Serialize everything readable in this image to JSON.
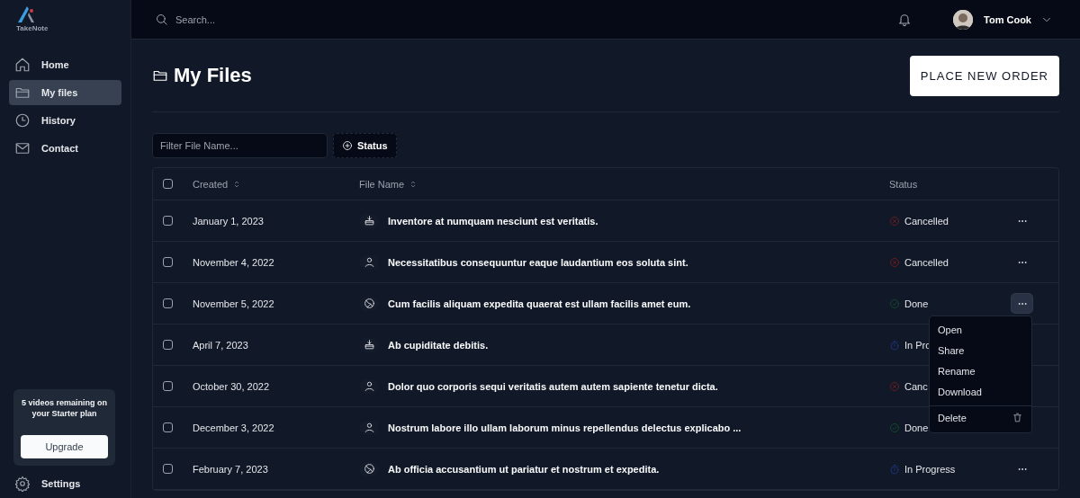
{
  "brand": {
    "name": "TakeNote"
  },
  "sidebar": {
    "items": [
      {
        "label": "Home",
        "selected": false
      },
      {
        "label": "My files",
        "selected": true
      },
      {
        "label": "History",
        "selected": false
      },
      {
        "label": "Contact",
        "selected": false
      }
    ],
    "plan_card": {
      "message": "5 videos remaining on your Starter plan",
      "button": "Upgrade"
    },
    "footer_item": {
      "label": "Settings"
    }
  },
  "topbar": {
    "search": {
      "placeholder": "Search..."
    },
    "user": {
      "name": "Tom Cook"
    }
  },
  "page": {
    "title": "My Files",
    "primary_button": "PLACE NEW ORDER"
  },
  "filters": {
    "filter": {
      "placeholder": "Filter File Name..."
    },
    "status_button": "Status"
  },
  "table": {
    "columns": [
      {
        "label": "Created",
        "sortable": true
      },
      {
        "label": "File Name",
        "sortable": true
      },
      {
        "label": "Status",
        "sortable": false
      }
    ],
    "header_checked": false,
    "rows": [
      {
        "checked": false,
        "created": "January 1, 2023",
        "kind": "inbox",
        "file_name": "Inventore at numquam nesciunt est veritatis.",
        "status": {
          "kind": "cancelled",
          "label": "Cancelled"
        },
        "actions_visible": true,
        "menu_open": false
      },
      {
        "checked": false,
        "created": "November 4, 2022",
        "kind": "user",
        "file_name": "Necessitatibus consequuntur eaque laudantium eos soluta sint.",
        "status": {
          "kind": "cancelled",
          "label": "Cancelled"
        },
        "actions_visible": true,
        "menu_open": false
      },
      {
        "checked": false,
        "created": "November 5, 2022",
        "kind": "globe",
        "file_name": "Cum facilis aliquam expedita quaerat est ullam facilis amet eum.",
        "status": {
          "kind": "done",
          "label": "Done"
        },
        "actions_visible": true,
        "menu_open": true
      },
      {
        "checked": false,
        "created": "April 7, 2023",
        "kind": "inbox",
        "file_name": "Ab cupiditate debitis.",
        "status": {
          "kind": "in_progress",
          "label": "In Pro"
        },
        "actions_visible": false
      },
      {
        "checked": false,
        "created": "October 30, 2022",
        "kind": "user",
        "file_name": "Dolor quo corporis sequi veritatis autem autem sapiente tenetur dicta.",
        "status": {
          "kind": "cancelled",
          "label": "Canc"
        },
        "actions_visible": false
      },
      {
        "checked": false,
        "created": "December 3, 2022",
        "kind": "user",
        "file_name": "Nostrum labore illo ullam laborum minus repellendus delectus explicabo ...",
        "status": {
          "kind": "done",
          "label": "Done"
        },
        "actions_visible": false
      },
      {
        "checked": false,
        "created": "February 7, 2023",
        "kind": "globe",
        "file_name": "Ab officia accusantium ut pariatur et nostrum et expedita.",
        "status": {
          "kind": "in_progress",
          "label": "In Progress"
        },
        "actions_visible": true,
        "menu_open": false
      }
    ]
  },
  "row_menu": {
    "items": [
      {
        "label": "Open",
        "kind": "plain"
      },
      {
        "label": "Share",
        "kind": "plain"
      },
      {
        "label": "Rename",
        "kind": "plain"
      },
      {
        "label": "Download",
        "kind": "plain"
      },
      {
        "label": "Delete",
        "kind": "danger"
      }
    ]
  }
}
